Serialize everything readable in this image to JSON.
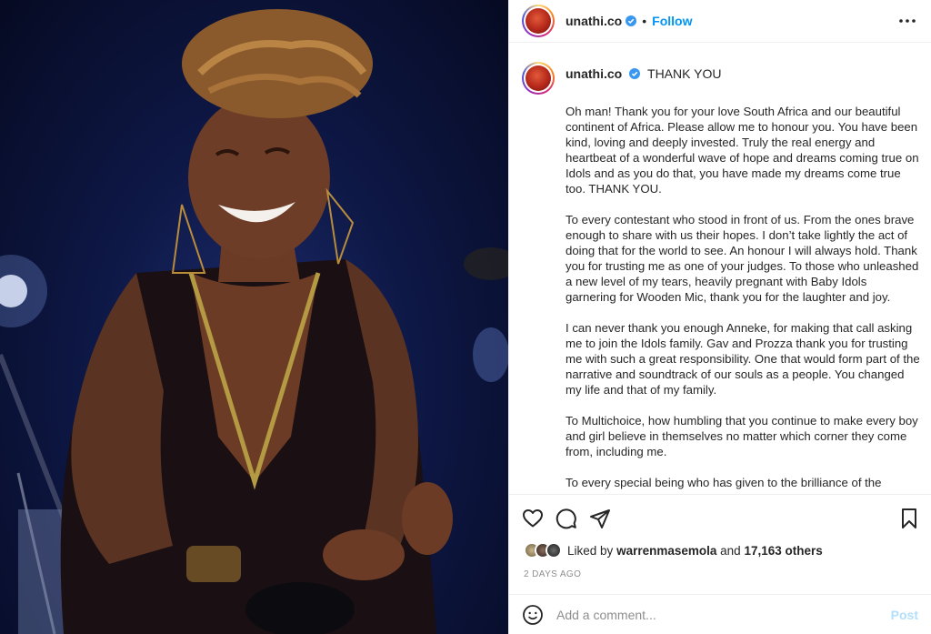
{
  "header": {
    "username": "unathi.co",
    "separator": "•",
    "follow_label": "Follow"
  },
  "caption": {
    "username": "unathi.co",
    "title": "THANK YOU",
    "paragraphs": [
      "Oh man! Thank you for your love South Africa and our beautiful continent of Africa. Please allow me to honour you. You have been kind, loving and deeply invested. Truly the real energy and heartbeat of a wonderful wave of hope and dreams coming true on Idols and as you do that, you have made my dreams come true too. THANK YOU.",
      "To every contestant who stood in front of us. From the ones brave enough to share with us their hopes. I don’t take lightly the act of doing that for the world to see. An honour I will always hold. Thank you for trusting me as one of your judges. To those who unleashed a new level of my tears, heavily pregnant with Baby Idols garnering for Wooden Mic, thank you for the laughter and joy.",
      "I can never thank you enough Anneke, for making that call asking me to join the Idols family. Gav and Prozza thank you for trusting me with such a great responsibility. One that would form part of the narrative and soundtrack of our souls as a people. You changed my life and that of my family.",
      "To Multichoice, how humbling that you continue to make every boy and girl believe in themselves no matter which corner they come from, including me.",
      "To every special being who has given to the brilliance of the"
    ]
  },
  "likes": {
    "prefix": "Liked by",
    "user": "warrenmasemola",
    "joiner": "and",
    "others": "17,163 others"
  },
  "timestamp": "2 DAYS AGO",
  "comment": {
    "placeholder": "Add a comment...",
    "post_label": "Post"
  },
  "colors": {
    "accent": "#0095f6",
    "post_disabled": "#b2dffc",
    "verified": "#3897f0"
  }
}
